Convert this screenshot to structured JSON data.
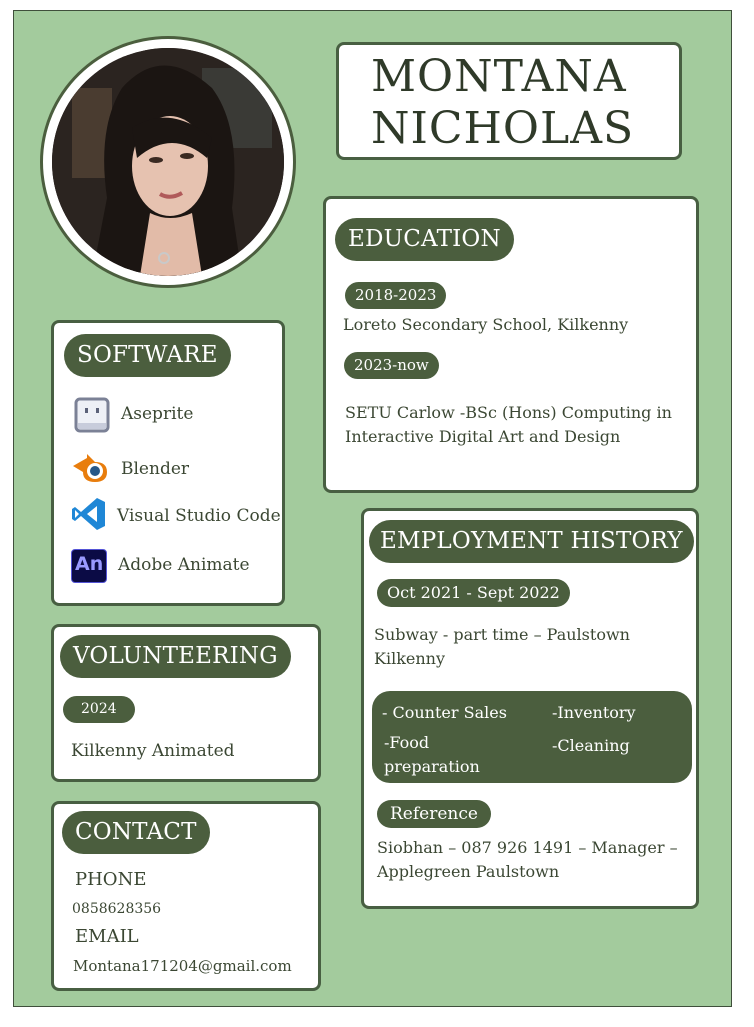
{
  "name": {
    "first": "MONTANA",
    "last": "NICHOLAS"
  },
  "education": {
    "heading": "EDUCATION",
    "entries": [
      {
        "years": "2018-2023",
        "text": "Loreto Secondary School, Kilkenny"
      },
      {
        "years": "2023-now",
        "line1": "SETU Carlow -BSc (Hons) Computing in",
        "line2": "Interactive Digital Art and Design"
      }
    ]
  },
  "software": {
    "heading": "SOFTWARE",
    "items": [
      {
        "label": "Aseprite",
        "icon": "aseprite-icon"
      },
      {
        "label": "Blender",
        "icon": "blender-icon"
      },
      {
        "label": "Visual Studio Code",
        "icon": "vscode-icon"
      },
      {
        "label": "Adobe Animate",
        "icon": "adobe-animate-icon",
        "icon_text": "An"
      }
    ]
  },
  "employment": {
    "heading": "EMPLOYMENT HISTORY",
    "period": "Oct 2021 - Sept 2022",
    "role_line1": "Subway - part time  – Paulstown",
    "role_line2": "Kilkenny",
    "skills": {
      "s1": "- Counter Sales",
      "s2": "-Inventory",
      "s3a": "-Food",
      "s3b": "preparation",
      "s4": "-Cleaning"
    },
    "reference_label": "Reference",
    "reference_line1": "Siobhan – 087 926 1491 – Manager –",
    "reference_line2": "Applegreen Paulstown"
  },
  "volunteering": {
    "heading": "VOLUNTEERING",
    "year": "2024",
    "text": "Kilkenny Animated"
  },
  "contact": {
    "heading": "CONTACT",
    "phone_label": "PHONE",
    "phone": "0858628356",
    "email_label": "EMAIL",
    "email": "Montana171204@gmail.com"
  },
  "colors": {
    "background": "#a3cb9d",
    "accent": "#4b5e3e",
    "card": "#ffffff"
  }
}
